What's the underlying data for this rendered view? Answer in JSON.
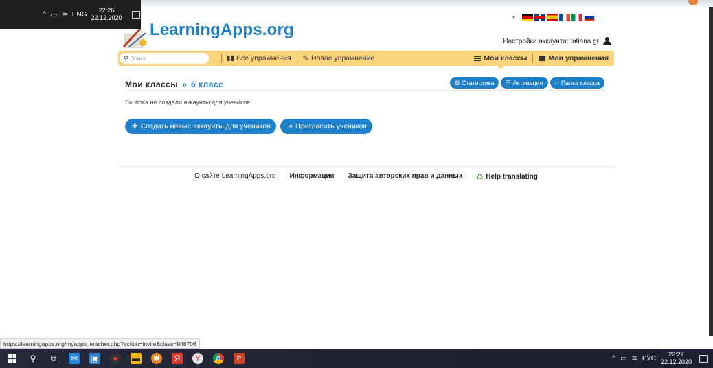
{
  "old_taskbar": {
    "lang": "ENG",
    "time": "22:26",
    "date": "22.12.2020"
  },
  "header": {
    "logo_text": "LearningApps.org",
    "account_label": "Настройки аккаунта: tatiana gr",
    "languages": [
      "de",
      "gb",
      "es",
      "fr",
      "it",
      "ru"
    ]
  },
  "navbar": {
    "search_placeholder": "Поиск",
    "all_exercises": "Все упражнения",
    "new_exercise": "Новое упражнение",
    "my_classes": "Мои классы",
    "my_exercises": "Мои упражнения"
  },
  "content": {
    "breadcrumb_root": "Мои классы",
    "breadcrumb_sep": "»",
    "breadcrumb_current": "6 класс",
    "btn_statistics": "Статистика",
    "btn_activation": "Активация",
    "btn_class_folder": "Папка класса",
    "note": "Вы пока не создали аккаунты для учеников.",
    "btn_create_accounts": "Создать новые аккаунты для учеников",
    "btn_invite": "Пригласить учеников"
  },
  "footer": {
    "about": "О сайте LearningApps.org",
    "info": "Информация",
    "copyright": "Защита авторских прав и данных",
    "help": "Help translating"
  },
  "statusbar": {
    "url": "https://learningapps.org/myapps_teacher.php?action=invite&class=948706"
  },
  "taskbar": {
    "apps": [
      "windows-icon",
      "search-icon",
      "task-view-icon",
      "mail-icon",
      "store-icon",
      "media-icon",
      "explorer-icon",
      "orange-app-icon",
      "yandex-icon",
      "yandex-browser-icon",
      "chrome-icon",
      "powerpoint-icon"
    ],
    "lang": "РУС",
    "time": "22:27",
    "date": "22.12.2020"
  },
  "colors": {
    "brand_blue": "#1d7fc7",
    "navbar_yellow": "#fbd37b"
  }
}
